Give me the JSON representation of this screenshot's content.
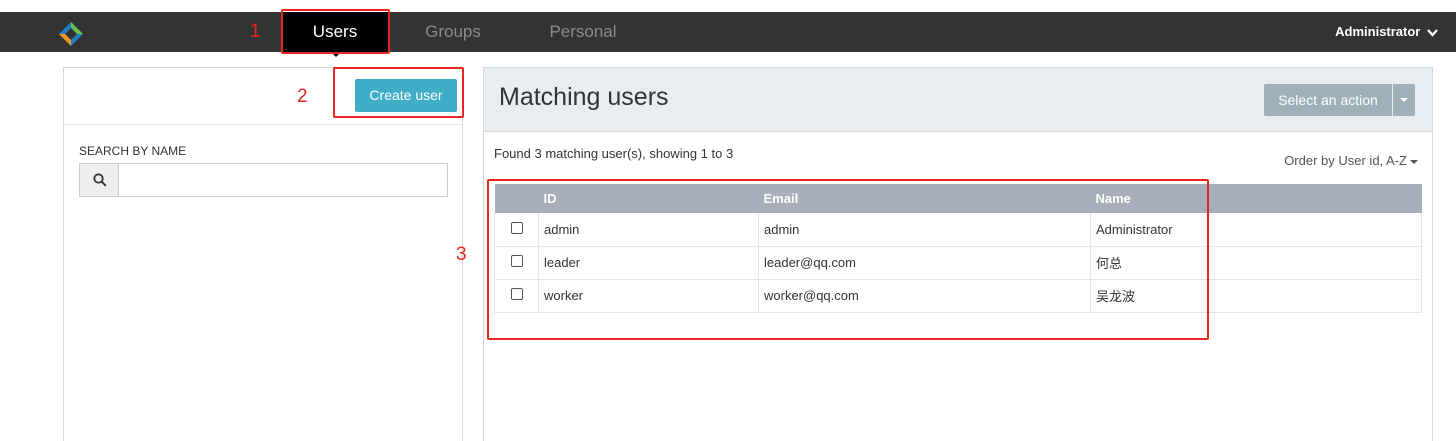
{
  "nav": {
    "tabs": [
      {
        "label": "Users",
        "active": true
      },
      {
        "label": "Groups",
        "active": false
      },
      {
        "label": "Personal",
        "active": false
      }
    ],
    "user_menu_label": "Administrator",
    "logo_icon": "diamond-logo-icon"
  },
  "left": {
    "create_button_label": "Create user",
    "search_label": "SEARCH BY NAME",
    "search_value": "",
    "search_icon": "search-icon"
  },
  "right": {
    "title": "Matching users",
    "action_button_label": "Select an action",
    "found_text": "Found 3 matching user(s), showing 1 to 3",
    "order_by_label": "Order by User id, A-Z"
  },
  "table": {
    "headers": [
      "ID",
      "Email",
      "Name"
    ],
    "rows": [
      {
        "id": "admin",
        "email": "admin",
        "name": "Administrator",
        "checked": false
      },
      {
        "id": "leader",
        "email": "leader@qq.com",
        "name": "何总",
        "checked": false
      },
      {
        "id": "worker",
        "email": "worker@qq.com",
        "name": "吴龙波",
        "checked": false
      }
    ]
  },
  "annotations": {
    "labels": [
      "1",
      "2",
      "3"
    ],
    "color": "#e8261f"
  },
  "colors": {
    "topbar": "#333333",
    "create_button": "#3fadc6",
    "action_button": "#9eb0b8",
    "table_header": "#a8afbb"
  }
}
